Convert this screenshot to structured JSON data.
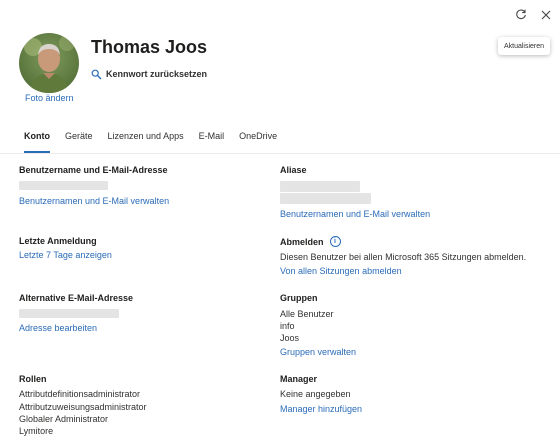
{
  "toolbar": {
    "refresh_icon": "refresh-icon",
    "close_icon": "close-icon",
    "tooltip": "Aktualisieren"
  },
  "header": {
    "user_name": "Thomas Joos",
    "change_photo": "Foto ändern",
    "reset_password": "Kennwort zurücksetzen",
    "reset_icon": "key-search-icon"
  },
  "tabs": [
    {
      "label": "Konto",
      "active": true
    },
    {
      "label": "Geräte",
      "active": false
    },
    {
      "label": "Lizenzen und Apps",
      "active": false
    },
    {
      "label": "E-Mail",
      "active": false
    },
    {
      "label": "OneDrive",
      "active": false
    }
  ],
  "left": {
    "username": {
      "title": "Benutzername und E-Mail-Adresse",
      "link": "Benutzernamen und E-Mail verwalten"
    },
    "last_login": {
      "title": "Letzte Anmeldung",
      "link": "Letzte 7 Tage anzeigen"
    },
    "alt_email": {
      "title": "Alternative E-Mail-Adresse",
      "link": "Adresse bearbeiten"
    },
    "roles": {
      "title": "Rollen",
      "items": [
        "Attributdefinitionsadministrator",
        "Attributzuweisungsadministrator",
        "Globaler Administrator",
        "Lymitore"
      ]
    }
  },
  "right": {
    "aliases": {
      "title": "Aliase",
      "link": "Benutzernamen und E-Mail verwalten"
    },
    "signout": {
      "title": "Abmelden",
      "text": "Diesen Benutzer bei allen Microsoft 365 Sitzungen abmelden.",
      "link": "Von allen Sitzungen abmelden"
    },
    "groups": {
      "title": "Gruppen",
      "items": [
        "Alle Benutzer",
        "info",
        "Joos"
      ],
      "link": "Gruppen verwalten"
    },
    "manager": {
      "title": "Manager",
      "text": "Keine angegeben",
      "link": "Manager hinzufügen"
    }
  },
  "colors": {
    "link": "#2b6cb8",
    "text": "#323130",
    "redacted": "#e4e4e4"
  }
}
